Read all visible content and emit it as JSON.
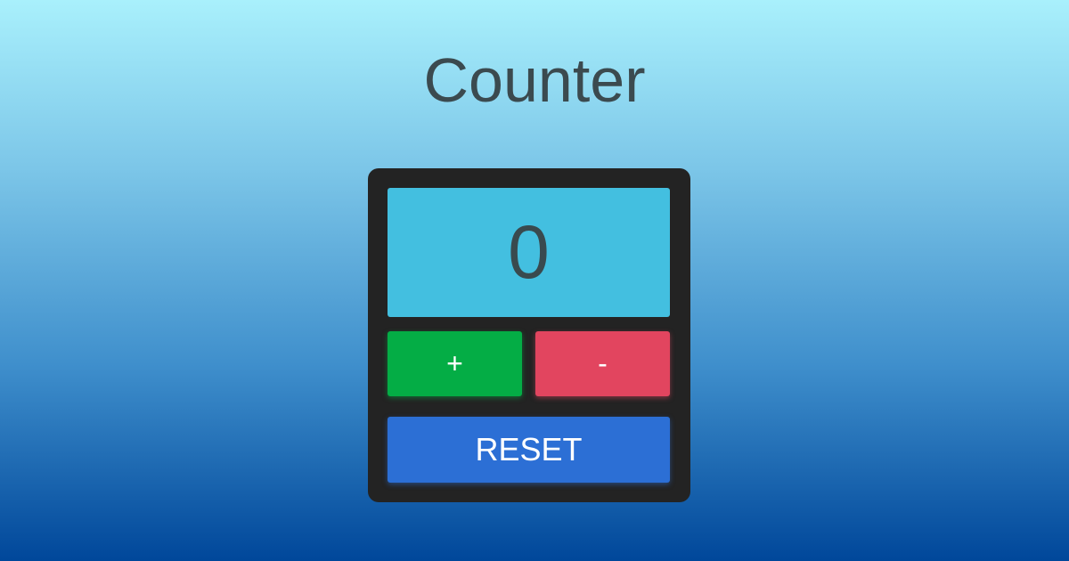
{
  "title": "Counter",
  "counter": {
    "value": "0"
  },
  "buttons": {
    "increment": "+",
    "decrement": "-",
    "reset": "RESET"
  },
  "colors": {
    "display": "#43bfe0",
    "increment": "#04ad45",
    "decrement": "#e2455f",
    "reset": "#2c6fd5",
    "card": "#232323"
  }
}
